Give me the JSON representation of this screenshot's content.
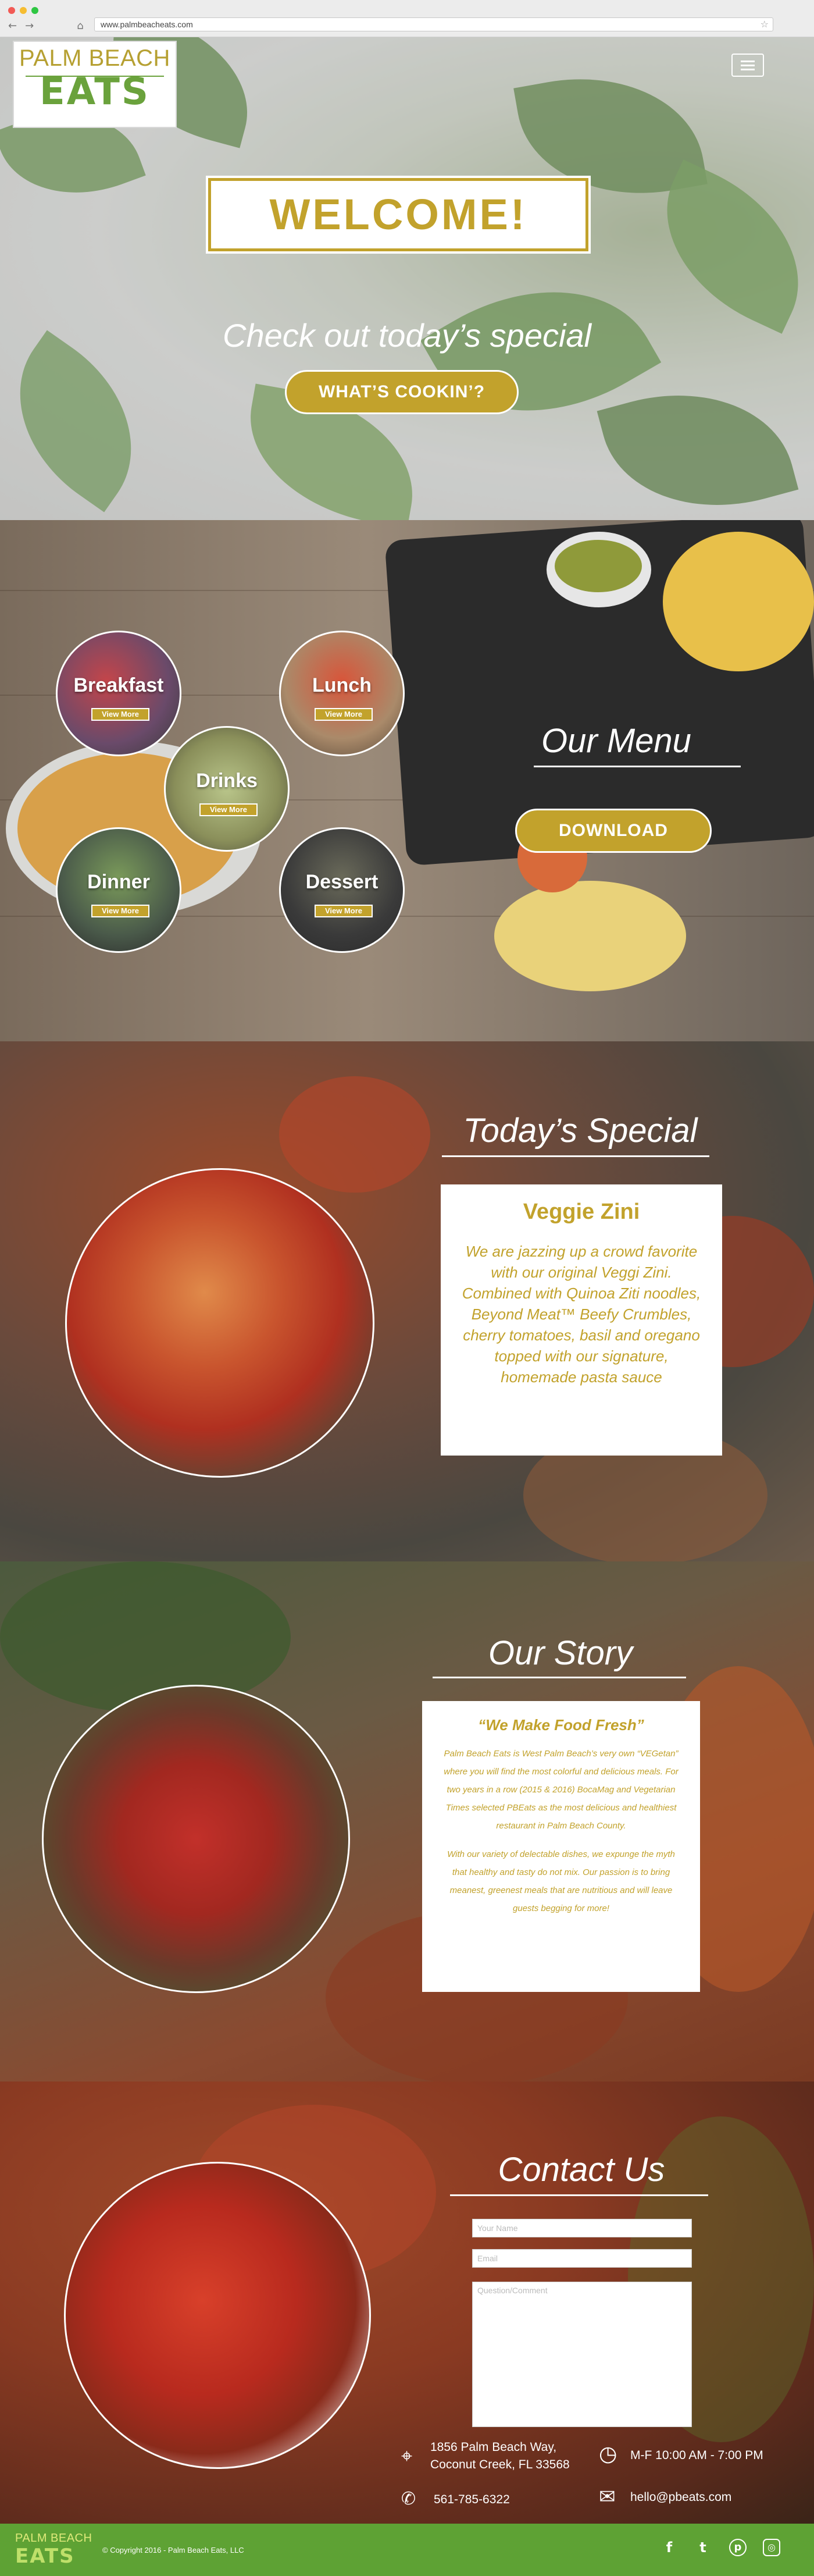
{
  "browser": {
    "url": "www.palmbeacheats.com",
    "back_icon": "←",
    "forward_icon": "→",
    "home_icon": "⌂",
    "bookmark_icon": "☆"
  },
  "colors": {
    "gold": "#c2a22c",
    "green": "#5ea234"
  },
  "logo": {
    "line1": "PALM BEACH",
    "line2": "EATS"
  },
  "hero": {
    "welcome": "WELCOME!",
    "subtitle": "Check out today’s special",
    "cta": "WHAT’S COOKIN’?"
  },
  "menu": {
    "title": "Our Menu",
    "download": "DOWNLOAD",
    "view_more": "View More",
    "items": [
      "Breakfast",
      "Lunch",
      "Drinks",
      "Dinner",
      "Dessert"
    ]
  },
  "special": {
    "title": "Today’s Special",
    "dish": "Veggie Zini",
    "description": "We are jazzing up a crowd favorite with our original Veggi Zini. Combined with Quinoa Ziti noodles, Beyond Meat™ Beefy Crumbles, cherry tomatoes, basil and oregano topped with our signature, homemade pasta sauce"
  },
  "story": {
    "title": "Our Story",
    "tagline": "“We Make Food Fresh”",
    "para1": "Palm Beach Eats is West Palm Beach’s very own “VEGetan” where you will find the most colorful and delicious meals. For two years in a row (2015 & 2016) BocaMag and Vegetarian Times selected PBEats as the most delicious and healthiest restaurant in Palm Beach County.",
    "para2": "With our variety of delectable dishes, we expunge the myth that healthy and tasty do not mix. Our passion is to bring meanest, greenest meals that are nutritious and will leave guests begging for more!"
  },
  "contact": {
    "title": "Contact Us",
    "name_placeholder": "Your Name",
    "email_placeholder": "Email",
    "message_placeholder": "Question/Comment",
    "address_line1": "1856 Palm Beach Way,",
    "address_line2": "Coconut Creek, FL 33568",
    "hours": "M-F 10:00 AM - 7:00 PM",
    "phone": "561-785-6322",
    "email": "hello@pbeats.com"
  },
  "footer": {
    "logo_line1": "PALM BEACH",
    "logo_line2": "EATS",
    "copyright": "© Copyright 2016 - Palm Beach Eats, LLC",
    "social": [
      "facebook-icon",
      "twitter-icon",
      "pinterest-icon",
      "instagram-icon"
    ]
  }
}
